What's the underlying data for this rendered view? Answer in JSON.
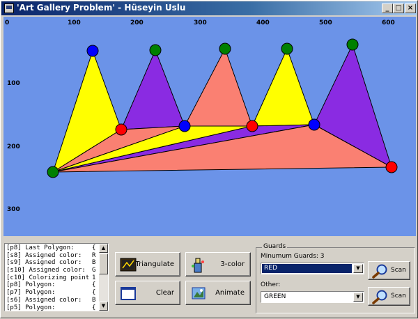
{
  "window": {
    "title": "'Art Gallery Problem' - Hüseyin Uslu"
  },
  "controls": {
    "minimize": "_",
    "maximize": "□",
    "close": "×"
  },
  "axes": {
    "x_ticks": [
      "0",
      "100",
      "200",
      "300",
      "400",
      "500",
      "600"
    ],
    "y_ticks": [
      "100",
      "200",
      "300"
    ]
  },
  "colors": {
    "canvas_bg": "#6b93e8",
    "yellow": "#ffff00",
    "purple": "#8a2be2",
    "salmon": "#fa8072",
    "red": "#ff0000",
    "green": "#008000",
    "blue": "#0000ff"
  },
  "log": {
    "lines": [
      {
        "key": "[p8] Last Polygon:",
        "val": "{"
      },
      {
        "key": "[s8] Assigned color:",
        "val": "R"
      },
      {
        "key": "[s9] Assigned color:",
        "val": "B"
      },
      {
        "key": "[s10] Assigned color:",
        "val": "G"
      },
      {
        "key": "[c10] Colorizing point",
        "val": "1"
      },
      {
        "key": "[p8] Polygon:",
        "val": "{"
      },
      {
        "key": "[p7] Polygon:",
        "val": "{"
      },
      {
        "key": "[s6] Assigned color:",
        "val": "B"
      },
      {
        "key": "[p5] Polygon:",
        "val": "{"
      }
    ]
  },
  "buttons": {
    "triangulate": "Triangulate",
    "three_color": "3-color",
    "clear": "Clear",
    "animate": "Animate"
  },
  "guards": {
    "legend": "Guards",
    "minimum_label": "Minumum Guards: 3",
    "selected_color": "RED",
    "other_label": "Other:",
    "other_color": "GREEN",
    "scan_label": "Scan"
  }
}
